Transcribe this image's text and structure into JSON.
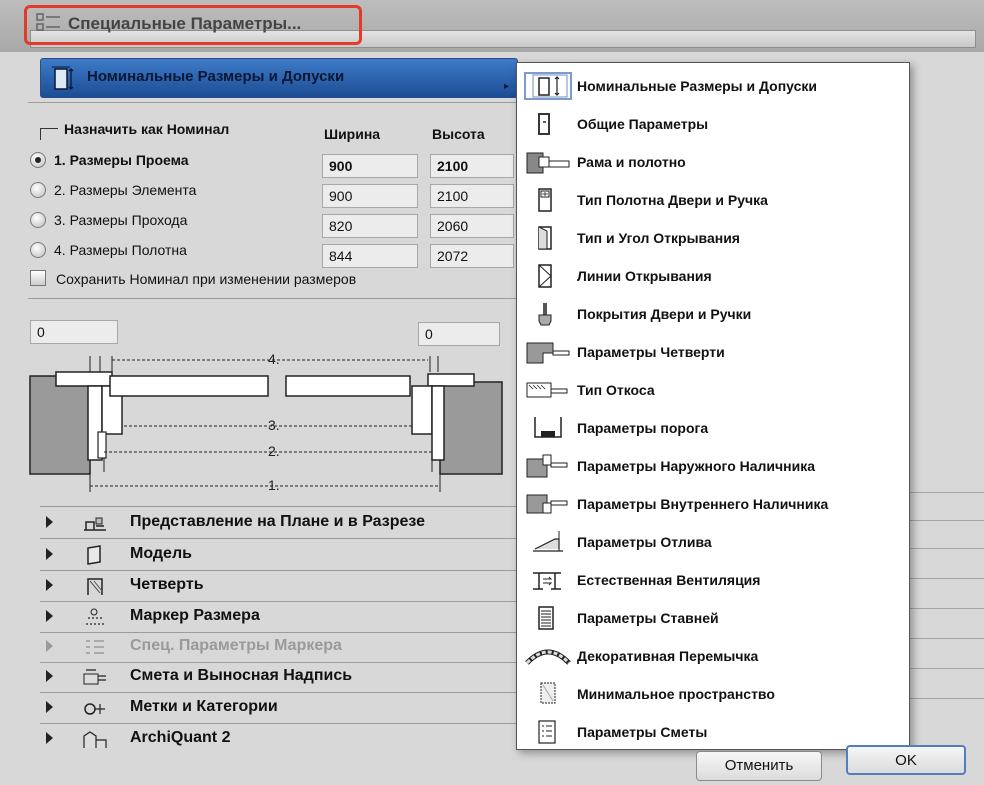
{
  "window": {
    "title": "Специальные Параметры..."
  },
  "section_header": {
    "label": "Номинальные Размеры и Допуски"
  },
  "nominal": {
    "group_label": "Назначить как Номинал",
    "col_width": "Ширина",
    "col_height": "Высота",
    "rows": [
      {
        "label": "1. Размеры Проема",
        "width": "900",
        "height": "2100",
        "selected": true
      },
      {
        "label": "2. Размеры Элемента",
        "width": "900",
        "height": "2100",
        "selected": false
      },
      {
        "label": "3. Размеры Прохода",
        "width": "820",
        "height": "2060",
        "selected": false
      },
      {
        "label": "4. Размеры Полотна",
        "width": "844",
        "height": "2072",
        "selected": false
      }
    ],
    "keep_nominal_label": "Сохранить Номинал при изменении размеров"
  },
  "diagram": {
    "left_value": "0",
    "right_value": "0",
    "dim_labels": [
      "4.",
      "3.",
      "2.",
      "1."
    ]
  },
  "tree": [
    {
      "label": "Представление на Плане и в Разрезе",
      "icon": "plan-section-icon",
      "disabled": false
    },
    {
      "label": "Модель",
      "icon": "model-icon",
      "disabled": false
    },
    {
      "label": "Четверть",
      "icon": "rebate-icon",
      "disabled": false
    },
    {
      "label": "Маркер Размера",
      "icon": "dimension-marker-icon",
      "disabled": false
    },
    {
      "label": "Спец. Параметры Маркера",
      "icon": "marker-params-icon",
      "disabled": true
    },
    {
      "label": "Смета и Выносная Надпись",
      "icon": "listing-label-icon",
      "disabled": false
    },
    {
      "label": "Метки и Категории",
      "icon": "tags-icon",
      "disabled": false
    },
    {
      "label": "ArchiQuant 2",
      "icon": "archiquant-icon",
      "disabled": false
    }
  ],
  "menu": [
    {
      "label": "Номинальные Размеры и Допуски",
      "icon": "nominal-size-icon"
    },
    {
      "label": "Общие Параметры",
      "icon": "door-icon"
    },
    {
      "label": "Рама и полотно",
      "icon": "frame-leaf-icon"
    },
    {
      "label": "Тип Полотна Двери и Ручка",
      "icon": "door-panel-icon"
    },
    {
      "label": "Тип и Угол Открывания",
      "icon": "opening-type-icon"
    },
    {
      "label": "Линии Открывания",
      "icon": "opening-lines-icon"
    },
    {
      "label": "Покрытия Двери и Ручки",
      "icon": "brush-icon"
    },
    {
      "label": "Параметры Четверти",
      "icon": "rebate-params-icon"
    },
    {
      "label": "Тип Откоса",
      "icon": "reveal-icon"
    },
    {
      "label": "Параметры порога",
      "icon": "threshold-icon"
    },
    {
      "label": "Параметры Наружного Наличника",
      "icon": "outer-casing-icon"
    },
    {
      "label": "Параметры Внутреннего Наличника",
      "icon": "inner-casing-icon"
    },
    {
      "label": "Параметры Отлива",
      "icon": "sill-icon"
    },
    {
      "label": "Естественная Вентиляция",
      "icon": "ventilation-icon"
    },
    {
      "label": "Параметры Ставней",
      "icon": "shutters-icon"
    },
    {
      "label": "Декоративная Перемычка",
      "icon": "arch-lintel-icon"
    },
    {
      "label": "Минимальное пространство",
      "icon": "min-space-icon"
    },
    {
      "label": "Параметры Сметы",
      "icon": "listing-icon"
    }
  ],
  "buttons": {
    "cancel": "Отменить",
    "ok": "OK"
  },
  "colors": {
    "header_blue": "#2a5ea8",
    "highlight_red": "#e23b2c"
  }
}
